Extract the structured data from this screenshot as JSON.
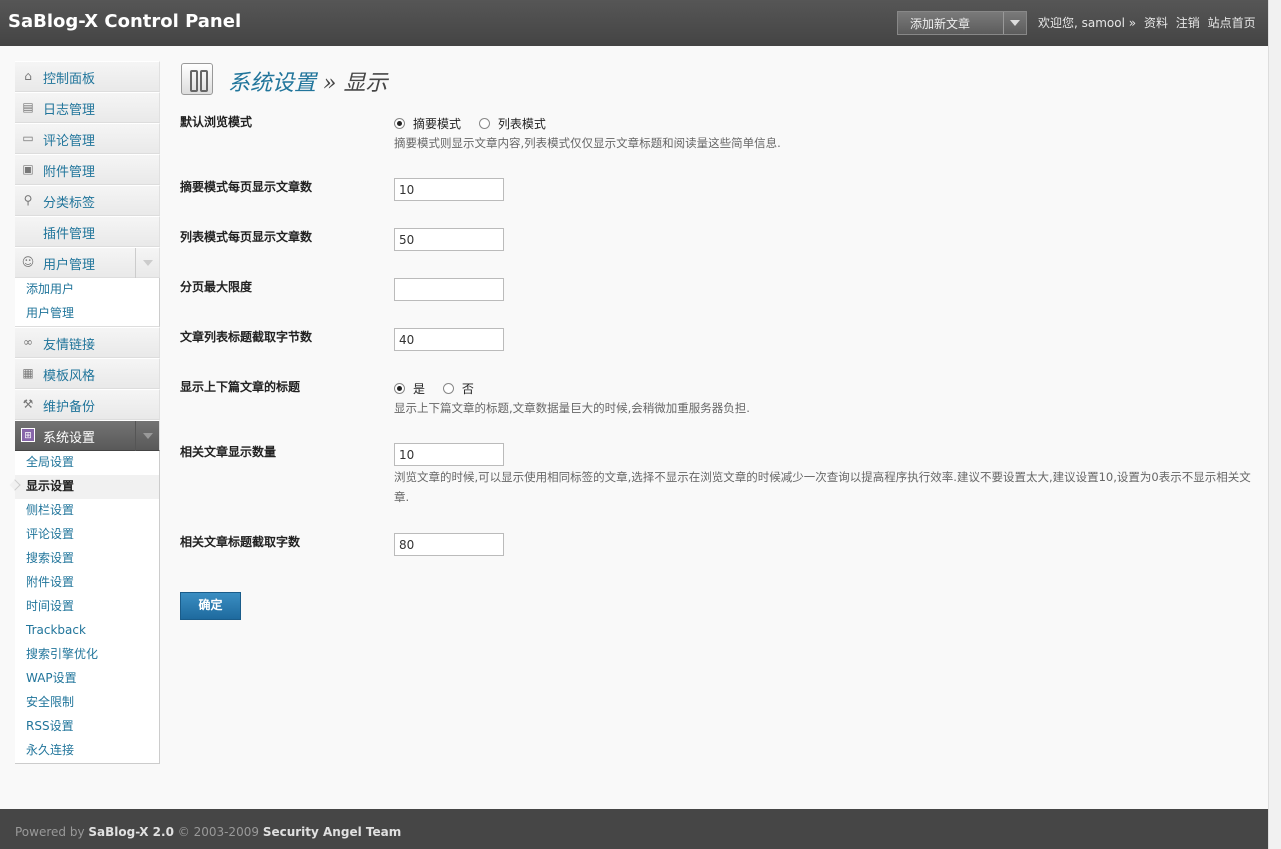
{
  "header": {
    "logo": "SaBlog-X Control Panel",
    "new_post": "添加新文章",
    "welcome": "欢迎您, samool »",
    "profile": "资料",
    "logout": "注销",
    "site_home": "站点首页"
  },
  "sidebar": {
    "items": [
      {
        "label": "控制面板",
        "icon": "home-icon"
      },
      {
        "label": "日志管理",
        "icon": "posts-icon"
      },
      {
        "label": "评论管理",
        "icon": "comments-icon"
      },
      {
        "label": "附件管理",
        "icon": "attachments-icon"
      },
      {
        "label": "分类标签",
        "icon": "pin-icon"
      },
      {
        "label": "插件管理",
        "icon": ""
      },
      {
        "label": "用户管理",
        "icon": "users-icon"
      },
      {
        "label": "友情链接",
        "icon": "link-icon"
      },
      {
        "label": "模板风格",
        "icon": "template-icon"
      },
      {
        "label": "维护备份",
        "icon": "tools-icon"
      },
      {
        "label": "系统设置",
        "icon": "settings-icon"
      }
    ],
    "user_sub": [
      "添加用户",
      "用户管理"
    ],
    "settings_sub": [
      "全局设置",
      "显示设置",
      "侧栏设置",
      "评论设置",
      "搜索设置",
      "附件设置",
      "时间设置",
      "Trackback",
      "搜索引擎优化",
      "WAP设置",
      "安全限制",
      "RSS设置",
      "永久连接"
    ]
  },
  "page": {
    "title_section": "系统设置",
    "title_sep": " » ",
    "title_page": "显示"
  },
  "form": {
    "view_mode": {
      "label": "默认浏览模式",
      "opt1": "摘要模式",
      "opt2": "列表模式",
      "selected": "摘要模式",
      "help": "摘要模式则显示文章内容,列表模式仅仅显示文章标题和阅读量这些简单信息."
    },
    "summary_per_page": {
      "label": "摘要模式每页显示文章数",
      "value": "10"
    },
    "list_per_page": {
      "label": "列表模式每页显示文章数",
      "value": "50"
    },
    "max_pages": {
      "label": "分页最大限度",
      "value": ""
    },
    "title_cut": {
      "label": "文章列表标题截取字节数",
      "value": "40"
    },
    "show_prev_next": {
      "label": "显示上下篇文章的标题",
      "opt1": "是",
      "opt2": "否",
      "selected": "是",
      "help": "显示上下篇文章的标题,文章数据量巨大的时候,会稍微加重服务器负担."
    },
    "related_count": {
      "label": "相关文章显示数量",
      "value": "10",
      "help": "浏览文章的时候,可以显示使用相同标签的文章,选择不显示在浏览文章的时候减少一次查询以提高程序执行效率.建议不要设置太大,建议设置10,设置为0表示不显示相关文章."
    },
    "related_title_cut": {
      "label": "相关文章标题截取字数",
      "value": "80"
    },
    "submit": "确定"
  },
  "footer": {
    "powered": "Powered by",
    "product": "SaBlog-X 2.0",
    "copy": "© 2003-2009",
    "team": "Security Angel Team"
  }
}
